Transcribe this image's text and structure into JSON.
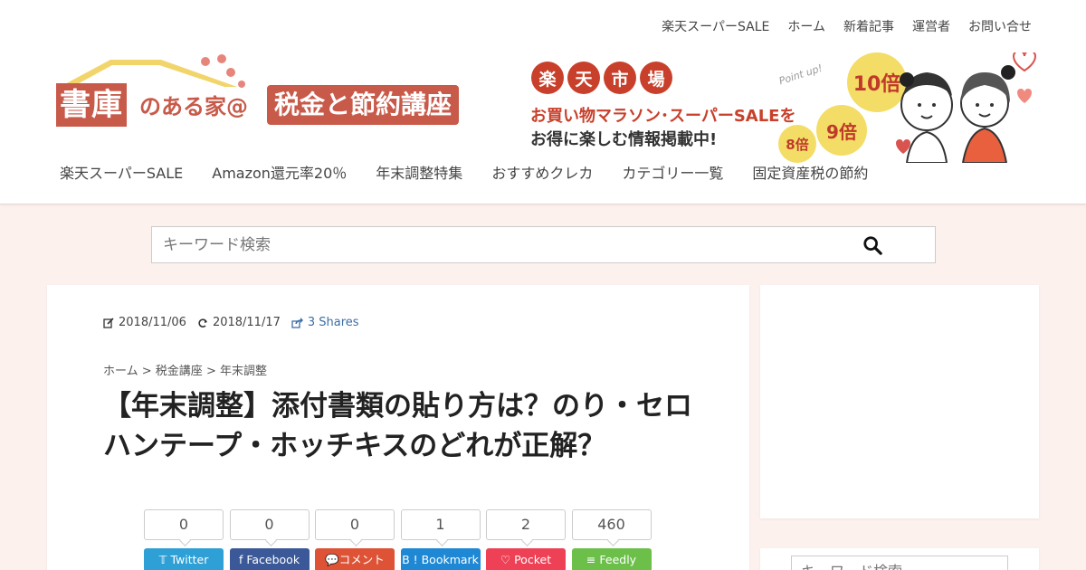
{
  "top_nav": [
    "楽天スーパーSALE",
    "ホーム",
    "新着記事",
    "運営者",
    "お問い合せ"
  ],
  "logo": {
    "part1": "書庫",
    "part2": "のある家@",
    "part3": "税金と節約講座"
  },
  "banner": {
    "rakuten": [
      "楽",
      "天",
      "市",
      "場"
    ],
    "line1": "お買い物マラソン･スーパーSALEを",
    "line2": "お得に楽しむ情報掲載中!",
    "point_up": "Point up!",
    "x10": "10倍",
    "x9": "9倍",
    "x8": "8倍"
  },
  "main_nav": [
    "楽天スーパーSALE",
    "Amazon還元率20％",
    "年末調整特集",
    "おすすめクレカ",
    "カテゴリー一覧",
    "固定資産税の節約"
  ],
  "search": {
    "placeholder": "キーワード検索"
  },
  "article": {
    "published": "2018/11/06",
    "updated": "2018/11/17",
    "shares": "3 Shares",
    "breadcrumb": [
      "ホーム",
      "税金講座",
      "年末調整"
    ],
    "title": "【年末調整】添付書類の貼り方は？のり・セロハンテープ・ホッチキスのどれが正解？"
  },
  "share_buttons": [
    {
      "count": "0",
      "label": "Twitter",
      "color": "#2ea0d6"
    },
    {
      "count": "0",
      "label": "Facebook",
      "color": "#3b5998"
    },
    {
      "count": "0",
      "label": "コメント",
      "color": "#de5236"
    },
    {
      "count": "1",
      "label": "B ! Bookmark",
      "color": "#1e88d4"
    },
    {
      "count": "2",
      "label": "Pocket",
      "color": "#ee4156"
    },
    {
      "count": "460",
      "label": "Feedly",
      "color": "#6cc04a"
    }
  ],
  "sidebar": {
    "search_placeholder": "キーワード検索"
  }
}
